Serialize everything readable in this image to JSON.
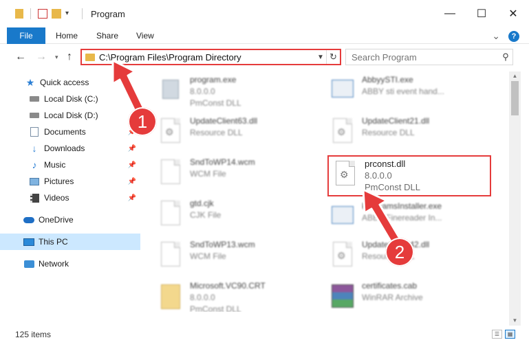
{
  "window": {
    "title": "Program",
    "minimize": "—",
    "maximize": "☐",
    "close": "✕"
  },
  "ribbon": {
    "file_tab": "File",
    "tabs": [
      "Home",
      "Share",
      "View"
    ],
    "expand": "⌄",
    "help": "?"
  },
  "address": {
    "path": "C:\\Program Files\\Program Directory",
    "search_placeholder": "Search Program"
  },
  "sidebar": {
    "items": [
      {
        "label": "Quick access",
        "icon": "star-icon"
      },
      {
        "label": "Local Disk (C:)",
        "icon": "drive-icon"
      },
      {
        "label": "Local Disk (D:)",
        "icon": "drive-icon"
      },
      {
        "label": "Documents",
        "icon": "documents-icon"
      },
      {
        "label": "Downloads",
        "icon": "download-icon"
      },
      {
        "label": "Music",
        "icon": "music-icon"
      },
      {
        "label": "Pictures",
        "icon": "pictures-icon"
      },
      {
        "label": "Videos",
        "icon": "videos-icon"
      },
      {
        "label": "OneDrive",
        "icon": "cloud-icon"
      },
      {
        "label": "This PC",
        "icon": "computer-icon"
      },
      {
        "label": "Network",
        "icon": "network-icon"
      }
    ]
  },
  "files": [
    {
      "name": "program.exe",
      "line2": "8.0.0.0",
      "line3": "PmConst DLL"
    },
    {
      "name": "AbbyySTI.exe",
      "line2": "ABBY sti event hand...",
      "line3": ""
    },
    {
      "name": "UpdateClient63.dll",
      "line2": "Resource DLL",
      "line3": ""
    },
    {
      "name": "UpdateClient21.dll",
      "line2": "Resource DLL",
      "line3": ""
    },
    {
      "name": "SndToWP14.wcm",
      "line2": "WCM File",
      "line3": ""
    },
    {
      "name": "prconst.dll",
      "line2": "8.0.0.0",
      "line3": "PmConst DLL"
    },
    {
      "name": "gtd.cjk",
      "line2": "CJK File",
      "line3": ""
    },
    {
      "name": "ProgramsInstaller.exe",
      "line2": "ABBY Finereader In...",
      "line3": ""
    },
    {
      "name": "SndToWP13.wcm",
      "line2": "WCM File",
      "line3": ""
    },
    {
      "name": "UpdateClient42.dll",
      "line2": "Resource DLL",
      "line3": ""
    },
    {
      "name": "Microsoft.VC90.CRT",
      "line2": "8.0.0.0",
      "line3": "PmConst DLL"
    },
    {
      "name": "certificates.cab",
      "line2": "WinRAR Archive",
      "line3": ""
    }
  ],
  "status": {
    "count": "125 items"
  },
  "annotations": {
    "marker1": "1",
    "marker2": "2",
    "color": "#e53b3b"
  }
}
